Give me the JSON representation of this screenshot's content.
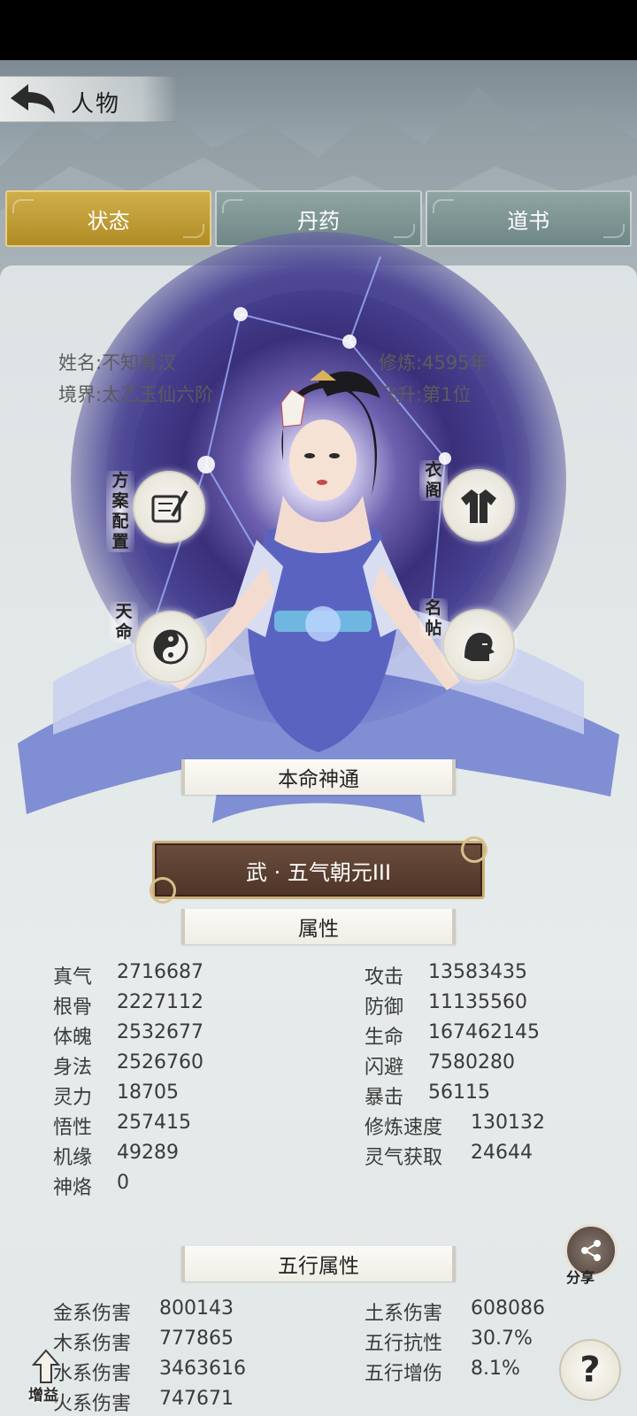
{
  "header": {
    "title": "人物"
  },
  "tabs": [
    {
      "label": "状态",
      "active": true
    },
    {
      "label": "丹药",
      "active": false
    },
    {
      "label": "道书",
      "active": false
    }
  ],
  "profile": {
    "name_label": "姓名:",
    "name_value": "不知有汉",
    "realm_label": "境界:",
    "realm_value": "太乙玉仙六阶",
    "cultivation_label": "修炼:",
    "cultivation_value": "4595年",
    "ascend_label": "飞升:",
    "ascend_value": "第1位"
  },
  "side_buttons": {
    "loadout": "方案配置",
    "wardrobe": "衣阁",
    "destiny": "天命",
    "namecard": "名帖"
  },
  "innate": {
    "title": "本命神通",
    "skill": "武 · 五气朝元III"
  },
  "attributes": {
    "title": "属性",
    "left": [
      {
        "name": "真气",
        "value": "2716687"
      },
      {
        "name": "根骨",
        "value": "2227112"
      },
      {
        "name": "体魄",
        "value": "2532677"
      },
      {
        "name": "身法",
        "value": "2526760"
      },
      {
        "name": "灵力",
        "value": "18705"
      },
      {
        "name": "悟性",
        "value": "257415"
      },
      {
        "name": "机缘",
        "value": "49289"
      },
      {
        "name": "神烙",
        "value": "0"
      }
    ],
    "right": [
      {
        "name": "攻击",
        "value": "13583435"
      },
      {
        "name": "防御",
        "value": "11135560"
      },
      {
        "name": "生命",
        "value": "167462145"
      },
      {
        "name": "闪避",
        "value": "7580280"
      },
      {
        "name": "暴击",
        "value": "56115"
      },
      {
        "name": "修炼速度",
        "value": "130132"
      },
      {
        "name": "灵气获取",
        "value": "24644"
      }
    ]
  },
  "five_elements": {
    "title": "五行属性",
    "left": [
      {
        "name": "金系伤害",
        "value": "800143"
      },
      {
        "name": "木系伤害",
        "value": "777865"
      },
      {
        "name": "水系伤害",
        "value": "3463616"
      },
      {
        "name": "火系伤害",
        "value": "747671"
      }
    ],
    "right": [
      {
        "name": "土系伤害",
        "value": "608086"
      },
      {
        "name": "五行抗性",
        "value": "30.7%"
      },
      {
        "name": "五行增伤",
        "value": "8.1%"
      }
    ]
  },
  "floating": {
    "share": "分享",
    "gain": "增益",
    "help": "?"
  },
  "colors": {
    "active_tab": "#b8942c",
    "inactive_tab": "#7b9291",
    "skill_bg": "#5a3e30"
  }
}
